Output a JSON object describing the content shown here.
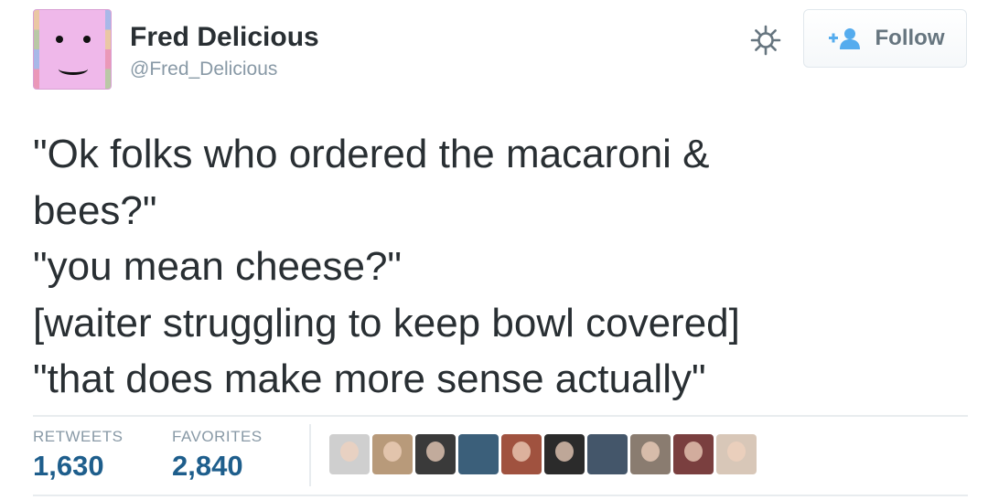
{
  "author": {
    "name": "Fred Delicious",
    "handle": "@Fred_Delicious",
    "avatar_color": "#efb8ea"
  },
  "actions": {
    "settings_icon": "gear-icon",
    "follow_label": "Follow",
    "follow_icon": "add-user-icon"
  },
  "tweet": {
    "lines": [
      "\"Ok folks who ordered the macaroni &",
      "bees?\"",
      "\"you mean cheese?\"",
      "[waiter struggling to keep bowl covered]",
      "\"that does make more sense actually\""
    ]
  },
  "stats": {
    "retweets_label": "RETWEETS",
    "retweets_value": "1,630",
    "favorites_label": "FAVORITES",
    "favorites_value": "2,840"
  },
  "favoriters": [
    {
      "name": "favoriter-avatar-1",
      "color": "#cfcfcf"
    },
    {
      "name": "favoriter-avatar-2",
      "color": "#b89a7a"
    },
    {
      "name": "favoriter-avatar-3",
      "color": "#3a3a3a"
    },
    {
      "name": "favoriter-avatar-4",
      "color": "#3b5f7a"
    },
    {
      "name": "favoriter-avatar-5",
      "color": "#a0523f"
    },
    {
      "name": "favoriter-avatar-6",
      "color": "#2b2b2b"
    },
    {
      "name": "favoriter-avatar-7",
      "color": "#44566a"
    },
    {
      "name": "favoriter-avatar-8",
      "color": "#8a7c70"
    },
    {
      "name": "favoriter-avatar-9",
      "color": "#7a3f3f"
    },
    {
      "name": "favoriter-avatar-10",
      "color": "#d8c7b8"
    }
  ],
  "colors": {
    "stat_value": "#1e5e8c",
    "muted": "#8899a6",
    "text": "#292f33"
  }
}
